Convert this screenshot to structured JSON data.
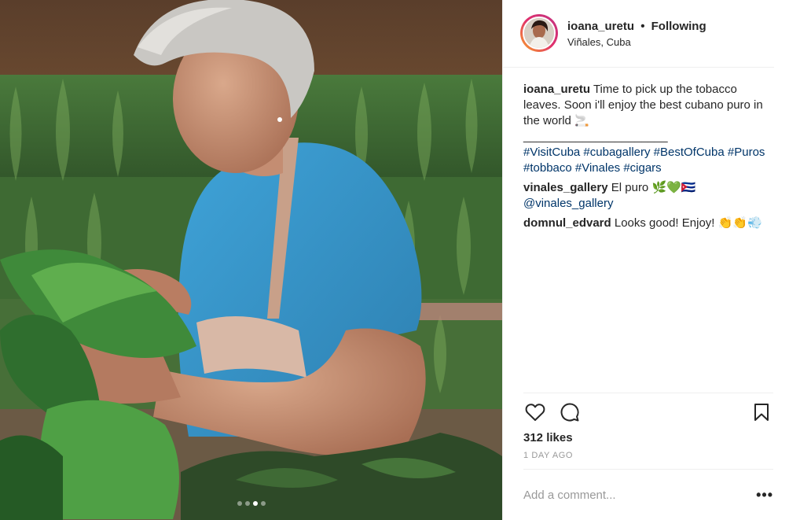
{
  "post": {
    "author": {
      "username": "ioana_uretu",
      "separator": "•",
      "follow_status": "Following",
      "location": "Viñales, Cuba"
    },
    "caption": {
      "username": "ioana_uretu",
      "text": "Time to pick up the tobacco leaves. Soon i'll enjoy the best cubano puro in the world 🚬",
      "divider": "______________________",
      "hashtags": "#VisitCuba #cubagallery #BestOfCuba #Puros #tobbaco #Vinales #cigars"
    },
    "comments": [
      {
        "username": "vinales_gallery",
        "text": "El puro 🌿💚🇨🇺",
        "mention": "@vinales_gallery"
      },
      {
        "username": "domnul_edvard",
        "text": "Looks good! Enjoy! 👏👏💨",
        "mention": ""
      }
    ],
    "likes": "312 likes",
    "timestamp": "1 DAY AGO",
    "add_comment_placeholder": "Add a comment...",
    "more_options": "•••",
    "carousel": {
      "count": 4,
      "active_index": 2
    }
  },
  "icons": {
    "like": "heart-icon",
    "comment": "comment-bubble-icon",
    "save": "bookmark-icon",
    "more": "more-dots-icon"
  },
  "colors": {
    "text": "#262626",
    "link": "#003569",
    "muted": "#999999",
    "border": "#efefef",
    "shirt": "#3c9bd0"
  }
}
